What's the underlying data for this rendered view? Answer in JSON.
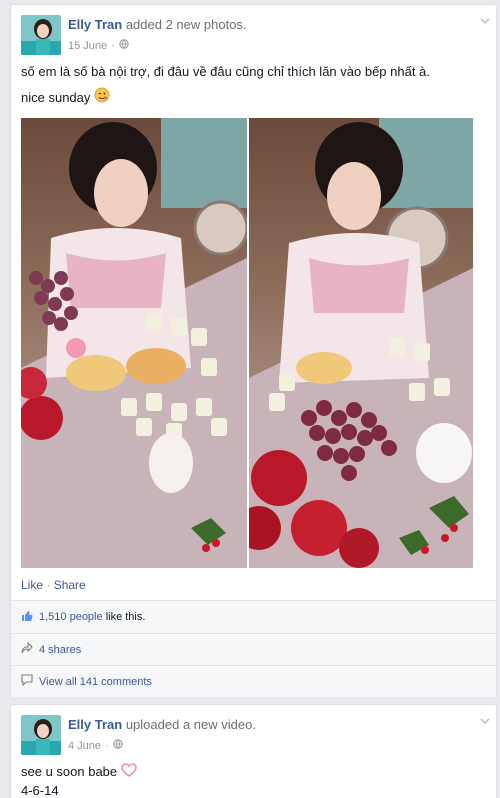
{
  "post1": {
    "author": "Elly Tran",
    "action": "added 2 new photos.",
    "date": "15 June",
    "text_line1": "số em là số bà nội trợ, đi đâu về đâu cũng chỉ thích lăn vào bếp nhất à.",
    "text_line2": "nice sunday",
    "like_label": "Like",
    "share_label": "Share",
    "likes_count": "1,510 people",
    "likes_suffix": "like this.",
    "shares": "4 shares",
    "comments": "View all 141 comments"
  },
  "post2": {
    "author": "Elly Tran",
    "action": "uploaded a new video.",
    "date": "4 June",
    "text_line1": "see u soon babe",
    "text_line2": "4-6-14"
  },
  "colors": {
    "link": "#3b5998",
    "background": "#e9eaed",
    "card": "#ffffff"
  },
  "icons": [
    "globe-icon",
    "chevron-down-icon",
    "thumbs-up-icon",
    "share-icon",
    "comment-icon",
    "wink-emoji-icon",
    "heart-icon"
  ]
}
